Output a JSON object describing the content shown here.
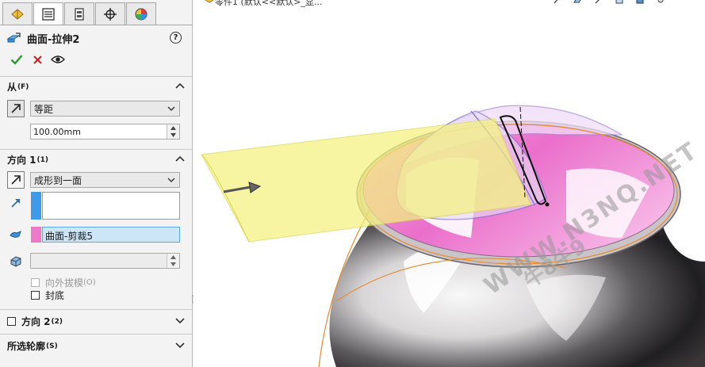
{
  "feature": {
    "title": "曲面-拉伸2",
    "help_glyph": "?",
    "actions": [
      "ok-icon",
      "cancel-icon",
      "preview-icon"
    ]
  },
  "tabs": [
    "feature-manager-icon",
    "property-manager-icon",
    "configuration-manager-icon",
    "dimxpert-icon",
    "display-manager-icon"
  ],
  "from": {
    "header": "从",
    "header_key": "(F)",
    "condition": "等距",
    "offset": "100.00mm"
  },
  "direction1": {
    "header": "方向 1",
    "header_key": "(1)",
    "end_condition": "成形到一面",
    "face_selection": "曲面-剪裁5",
    "draft_outward": "向外拔模",
    "draft_outward_key": "(O)",
    "cap_end": "封底"
  },
  "direction2": {
    "header": "方向 2",
    "header_key": "(2)"
  },
  "selected_contours": {
    "header": "所选轮廓",
    "header_key": "(S)"
  },
  "viewport": {
    "crumb": "零件1 (默认<<默认>_显...",
    "watermark_main": "WWW.N3NQ.NET",
    "watermark_sub": "牛8牛9"
  },
  "colors": {
    "direction_blue": "#3d9be9",
    "face_pink": "#ef79c9",
    "selection_bg": "#cde6f7",
    "ok_green": "#2f9a2f",
    "cancel_red": "#d42020",
    "extrude_yellow": "#f4f27e"
  }
}
